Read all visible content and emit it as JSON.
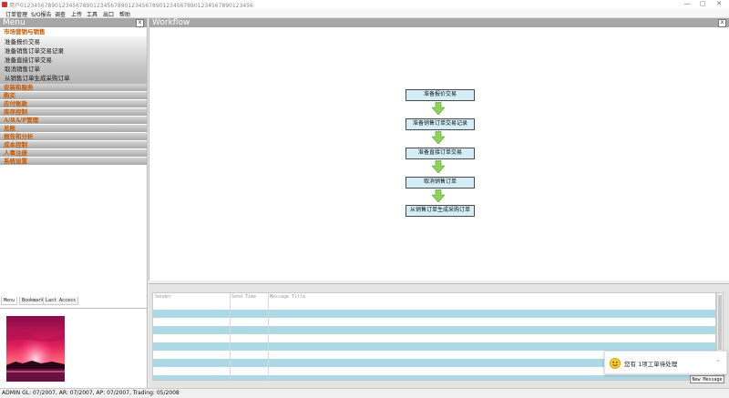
{
  "window": {
    "title": "用户0123456789012345678901234567890123456789012345678901234567890123456",
    "buttons": {
      "minimize": "—",
      "maximize": "▢",
      "close": "✕"
    }
  },
  "menubar": [
    "订单管理",
    "S/O报告",
    "调查",
    "上传",
    "工具",
    "出口",
    "帮助"
  ],
  "left_panel": {
    "title": "Menu",
    "close": "x",
    "open_group": "市场营销与销售",
    "sub_items": [
      "准备报价交易",
      "准备销售订单交易记录",
      "准备直接订单交易",
      "取消销售订单",
      "从销售订单生成采购订单"
    ],
    "groups": [
      "安装和服务",
      "购买",
      "应付账款",
      "库存控制",
      "A/RA/P管理",
      "总账",
      "报告和分析",
      "成本控制",
      "人事注册",
      "系统设置"
    ],
    "tabs": [
      "Menu",
      "Bookmark",
      "Last Access"
    ]
  },
  "workflow": {
    "title": "Workflow",
    "close": "x",
    "steps": [
      "准备报价交易",
      "准备销售订单交易记录",
      "准备直接订单交易",
      "取消销售订单",
      "从销售订单生成采购订单"
    ]
  },
  "messages": {
    "columns": [
      "Sender",
      "Send Time",
      "Message Title"
    ],
    "new_message_label": "New Message"
  },
  "toast": {
    "text": "您有 1项工单待处理",
    "chevron": "⌄"
  },
  "status": {
    "text": "ADMIN  GL: 07/2007, AR: 07/2007, AP: 07/2007, Trading: 05/2008"
  }
}
